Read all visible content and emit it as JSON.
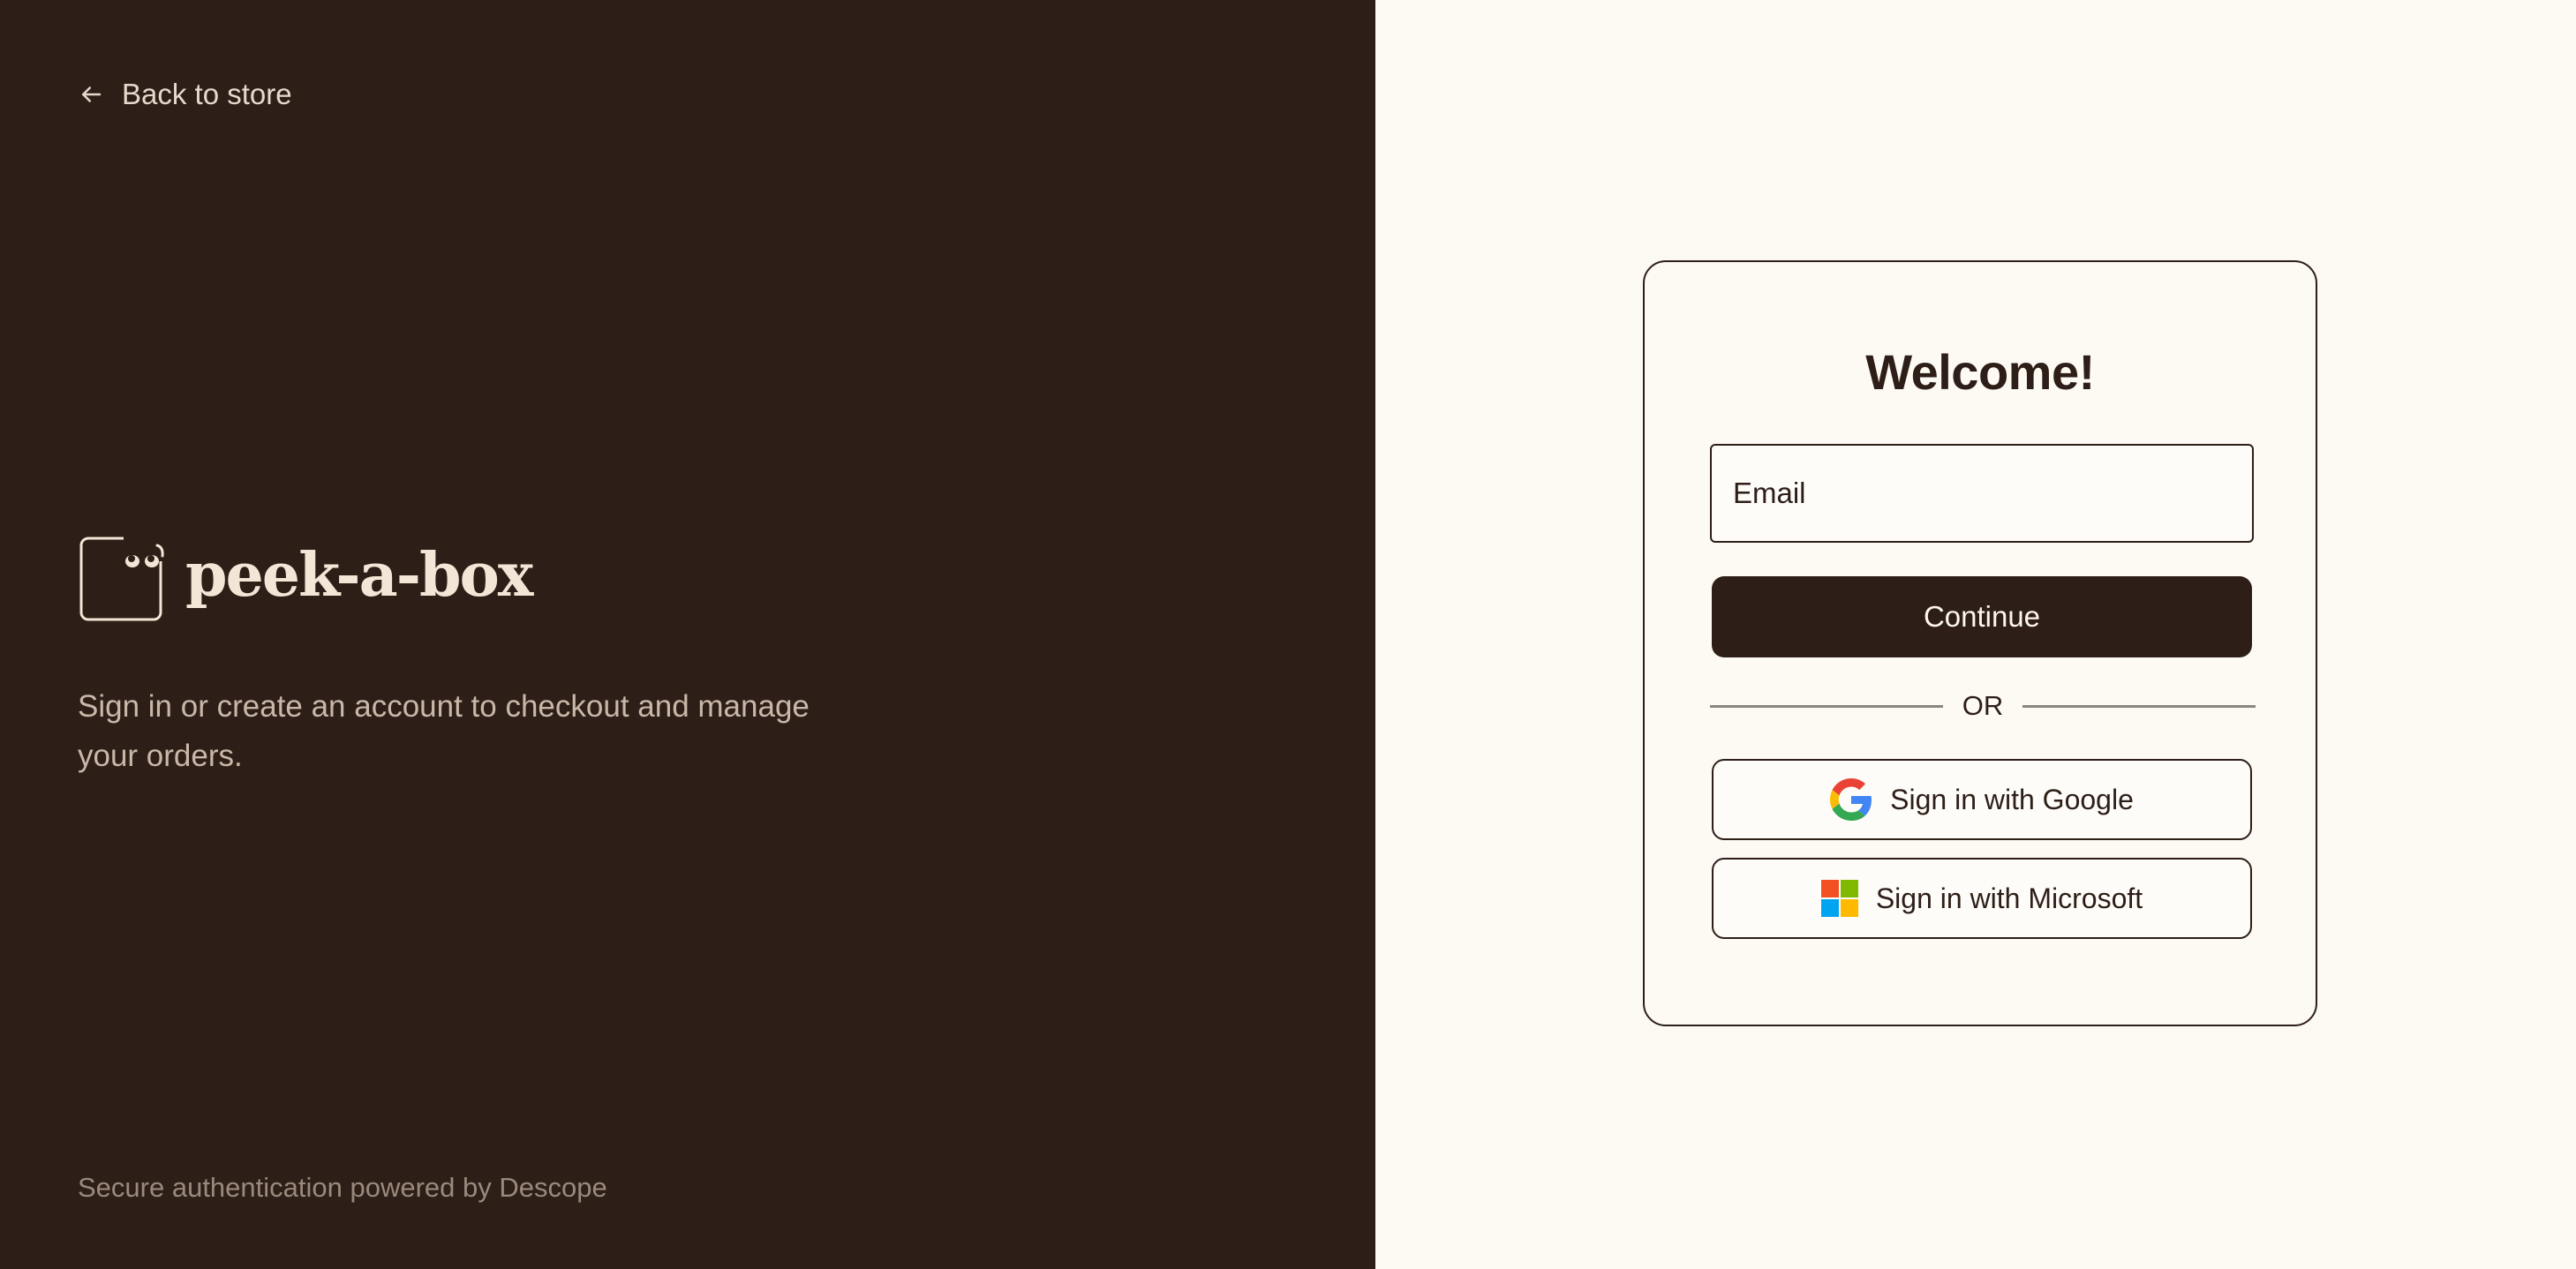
{
  "left_panel": {
    "back_link": "Back to store",
    "brand_name": "peek-a-box",
    "tagline": "Sign in or create an account to checkout and manage your orders.",
    "footer": "Secure authentication powered by Descope"
  },
  "login_card": {
    "title": "Welcome!",
    "email": {
      "placeholder": "Email",
      "value": ""
    },
    "continue_label": "Continue",
    "divider_label": "OR",
    "google_label": "Sign in with Google",
    "microsoft_label": "Sign in with Microsoft"
  },
  "icons": {
    "back": "arrow-left-icon",
    "brand_logo": "peeking-box-logo",
    "google": "google-icon",
    "microsoft": "microsoft-icon"
  },
  "colors": {
    "dark_brown": "#2d1e17",
    "cream": "#fcf8f2",
    "light_text": "#e6d9cb",
    "muted_text": "#9a8a7d"
  }
}
